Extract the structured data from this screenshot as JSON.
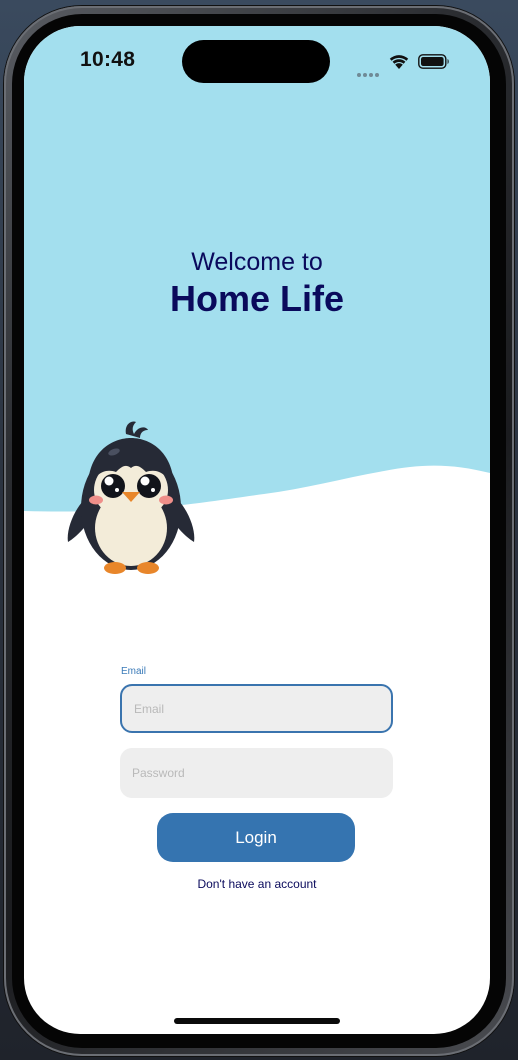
{
  "status_bar": {
    "time": "10:48"
  },
  "hero": {
    "welcome_text": "Welcome to",
    "app_name": "Home Life"
  },
  "form": {
    "email_label": "Email",
    "email_placeholder": "Email",
    "email_value": "",
    "password_placeholder": "Password",
    "password_value": "",
    "login_label": "Login",
    "signup_link": "Don't have an account"
  },
  "colors": {
    "sky": "#a3dfee",
    "title_navy": "#0a0a5c",
    "primary_button": "#3574b0",
    "focused_border": "#3a74ae",
    "input_background": "#eeeeee"
  },
  "icons": {
    "mascot": "penguin-mascot",
    "signal": "cellular-signal-icon",
    "wifi": "wifi-icon",
    "battery": "battery-icon"
  }
}
